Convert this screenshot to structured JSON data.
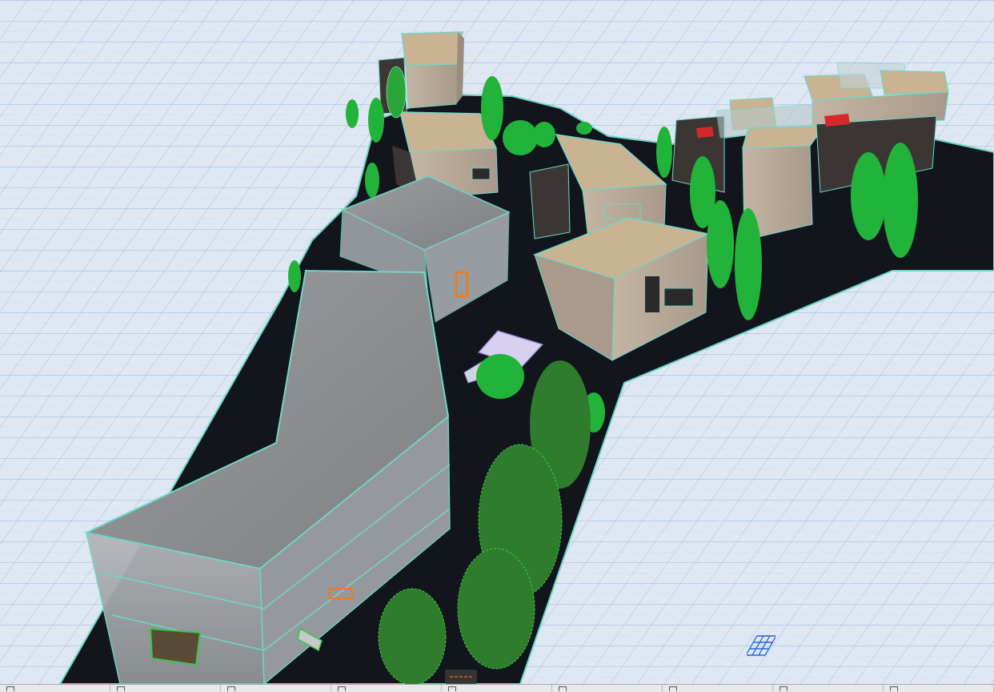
{
  "app": {
    "view": "3D Window",
    "ui_text": []
  },
  "colors": {
    "ground_grid": "#dfe8f2",
    "grid_line": "#8fb0dc",
    "site_slab": "#12161c",
    "slab_edge": "#6fd6c8",
    "roof_gray": "#8c8e90",
    "glass_wall": "#a7aaad",
    "stone_wall": "#b7a897",
    "roof_stone": "#c9b393",
    "dark_wall": "#3b3634",
    "tree_green": "#21b33a",
    "tree_dark": "#2f7c2c",
    "accent_orange": "#f07a19",
    "accent_red": "#d22a2a"
  },
  "toolbar": {
    "icons": [
      "arrow-icon",
      "layers-icon",
      "pencil-icon",
      "grid-icon",
      "plan-icon",
      "stairs-icon",
      "rectangle-icon",
      "object-icon",
      "section-icon"
    ]
  }
}
